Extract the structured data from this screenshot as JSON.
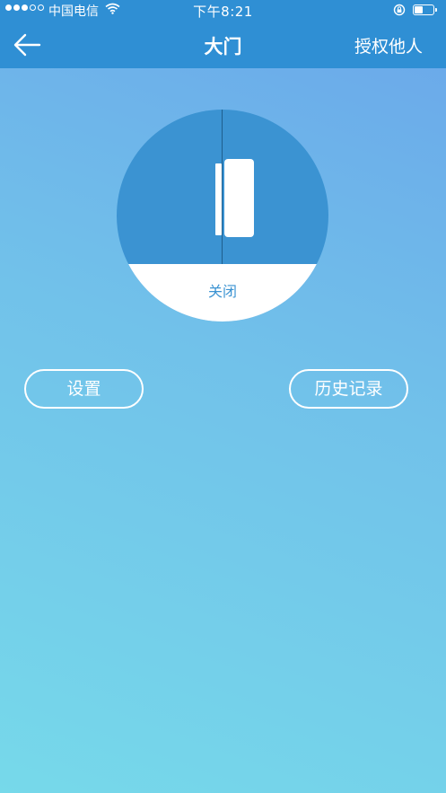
{
  "status_bar": {
    "carrier": "中国电信",
    "time": "下午8:21",
    "signal_bars_filled": 3,
    "signal_bars_total": 5
  },
  "nav": {
    "back_icon": "back-arrow-icon",
    "title": "大门",
    "authorize_label": "授权他人"
  },
  "sensor": {
    "state_label": "关闭"
  },
  "actions": {
    "settings_label": "设置",
    "history_label": "历史记录"
  },
  "colors": {
    "header": "#2f8fd4",
    "sensor_fill": "#3b93d2",
    "background_top": "#6aa6ea",
    "background_bottom": "#76d9ea"
  }
}
